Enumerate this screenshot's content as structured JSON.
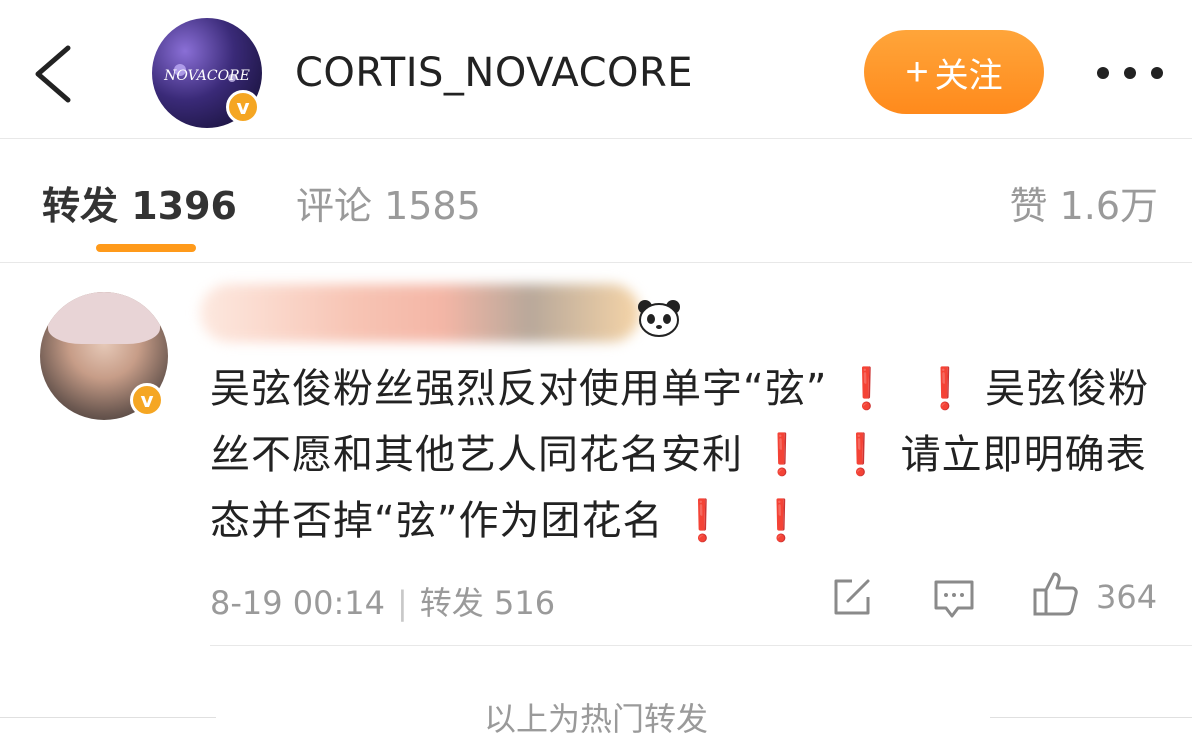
{
  "header": {
    "username": "CORTIS_NOVACORE",
    "follow_plus": "+",
    "follow_label": "关注",
    "verified_mark": "v",
    "avatar_logo_text": "NOVACORE"
  },
  "tabs": {
    "repost": "转发 1396",
    "comment": "评论 1585",
    "like": "赞 1.6万"
  },
  "post": {
    "verified_mark": "v",
    "line1": "吴弦俊粉丝强烈反对使用单字“弦”",
    "line2": "吴弦俊粉丝不愿和其他艺人同花名安利",
    "line3": "请立即明确表态并否掉“弦”作为团花名",
    "excl": "❗",
    "timestamp": "8-19 00:14",
    "separator": "|",
    "repost_label": "转发 516",
    "like_count": "364"
  },
  "footer": {
    "text": "以上为热门转发"
  },
  "colors": {
    "accent": "#ff9a1a",
    "follow_bg": "#ff8a1c",
    "verified": "#f5a623",
    "exclamation": "#e0201c",
    "muted_text": "#9a9a9a"
  },
  "icons": {
    "back": "chevron-left-icon",
    "more": "more-dots-icon",
    "panda": "panda-emoji-icon",
    "share": "share-edit-icon",
    "comment": "comment-icon",
    "like": "thumbs-up-icon"
  }
}
